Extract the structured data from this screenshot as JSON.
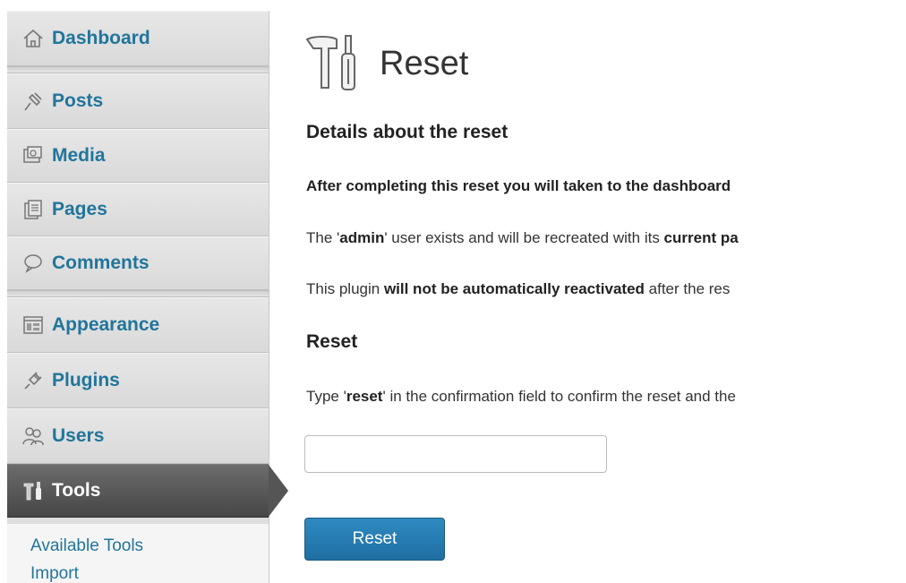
{
  "sidebar": {
    "items": [
      {
        "label": "Dashboard",
        "icon": "dashboard-icon"
      },
      {
        "label": "Posts",
        "icon": "posts-icon"
      },
      {
        "label": "Media",
        "icon": "media-icon"
      },
      {
        "label": "Pages",
        "icon": "pages-icon"
      },
      {
        "label": "Comments",
        "icon": "comments-icon"
      },
      {
        "label": "Appearance",
        "icon": "appearance-icon"
      },
      {
        "label": "Plugins",
        "icon": "plugins-icon"
      },
      {
        "label": "Users",
        "icon": "users-icon"
      },
      {
        "label": "Tools",
        "icon": "tools-icon",
        "active": true
      }
    ],
    "submenu": [
      {
        "label": "Available Tools"
      },
      {
        "label": "Import"
      }
    ]
  },
  "page": {
    "title": "Reset",
    "title_icon": "tools-icon",
    "details_heading": "Details about the reset",
    "details": {
      "line1": "After completing this reset you will taken to the dashboard",
      "line2_pre": "The '",
      "line2_bold1": "admin",
      "line2_mid": "' user exists and will be recreated with its ",
      "line2_bold2": "current pa",
      "line3_pre": "This plugin ",
      "line3_bold": "will not be automatically reactivated",
      "line3_post": " after the res"
    },
    "reset_heading": "Reset",
    "instruction_pre": "Type '",
    "instruction_bold": "reset",
    "instruction_post": "' in the confirmation field to confirm the reset and the",
    "confirm_input": {
      "value": "",
      "placeholder": ""
    },
    "reset_button_label": "Reset"
  },
  "colors": {
    "link": "#21759b",
    "active_menu": "#555555",
    "button": "#2179ae"
  }
}
